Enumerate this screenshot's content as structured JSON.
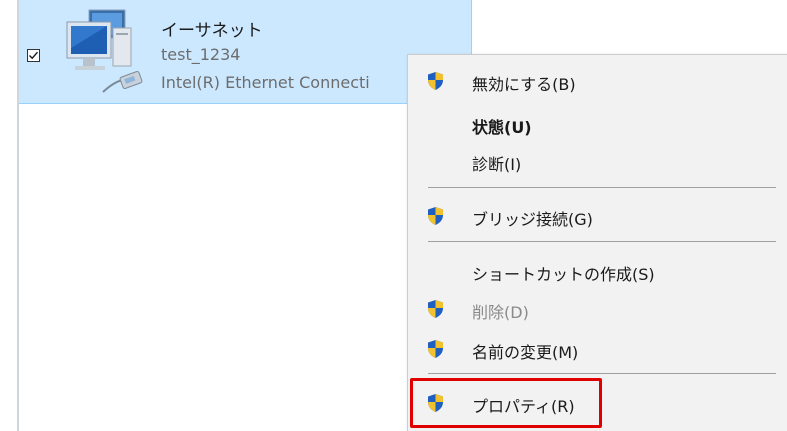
{
  "adapter": {
    "checked": true,
    "name": "イーサネット",
    "network": "test_1234",
    "device": "Intel(R) Ethernet Connecti",
    "icon": "network-adapter-icon"
  },
  "context_menu": {
    "items": [
      {
        "label": "無効にする(B)",
        "shield": true,
        "bold": false,
        "disabled": false
      },
      {
        "label": "状態(U)",
        "shield": false,
        "bold": true,
        "disabled": false
      },
      {
        "label": "診断(I)",
        "shield": false,
        "bold": false,
        "disabled": false
      },
      {
        "label": "ブリッジ接続(G)",
        "shield": true,
        "bold": false,
        "disabled": false
      },
      {
        "label": "ショートカットの作成(S)",
        "shield": false,
        "bold": false,
        "disabled": false
      },
      {
        "label": "削除(D)",
        "shield": true,
        "bold": false,
        "disabled": true
      },
      {
        "label": "名前の変更(M)",
        "shield": true,
        "bold": false,
        "disabled": false
      },
      {
        "label": "プロパティ(R)",
        "shield": true,
        "bold": false,
        "disabled": false
      }
    ],
    "highlighted_item": "プロパティ(R)"
  },
  "colors": {
    "selection": "#cce8ff",
    "highlight_border": "#e00000",
    "shield_blue": "#1f5fbf",
    "shield_yellow": "#f2c12e"
  }
}
